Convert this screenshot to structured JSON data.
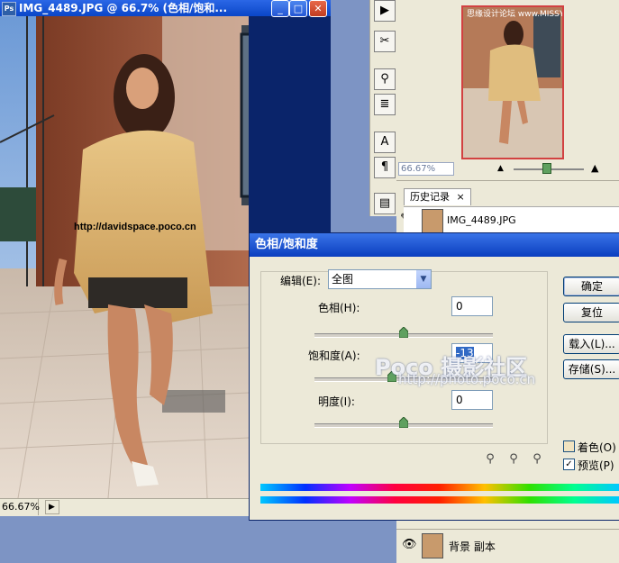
{
  "doc_window": {
    "title": "IMG_4489.JPG @ 66.7% (色相/饱和...",
    "app_icon_label": "Ps",
    "minimize_glyph": "_",
    "maximize_glyph": "□",
    "close_glyph": "✕",
    "watermark_url": "http://davidspace.poco.cn",
    "zoom_status": "66.67%"
  },
  "navigator": {
    "zoom": "66.67%",
    "thumb_watermark": "思缘设计论坛 www.MISSYUAN.COM"
  },
  "history": {
    "tab_label": "历史记录",
    "tab_close": "×",
    "snapshot_name": "IMG_4489.JPG"
  },
  "layers": {
    "layer_name": "背景 副本"
  },
  "dialog": {
    "title": "色相/饱和度",
    "edit_label": "编辑(E):",
    "edit_value": "全图",
    "hue_label": "色相(H):",
    "hue_value": "0",
    "hue_level": 0.5,
    "saturation_label": "饱和度(A):",
    "saturation_value": "-13",
    "saturation_level": 0.435,
    "lightness_label": "明度(I):",
    "lightness_value": "0",
    "lightness_level": 0.5,
    "buttons": {
      "ok": "确定",
      "reset": "复位",
      "load": "载入(L)...",
      "save": "存储(S)..."
    },
    "colorize_label": "着色(O)",
    "colorize_checked": false,
    "preview_label": "预览(P)",
    "preview_checked": true,
    "checkmark": "✓"
  },
  "watermark": {
    "main": "Poco 摄影社区",
    "url": "http://photo.poco.cn"
  },
  "colors": {
    "titlebar": "#0a46c8",
    "dialog_bg": "#ece9d8",
    "selection": "#316ac5"
  }
}
